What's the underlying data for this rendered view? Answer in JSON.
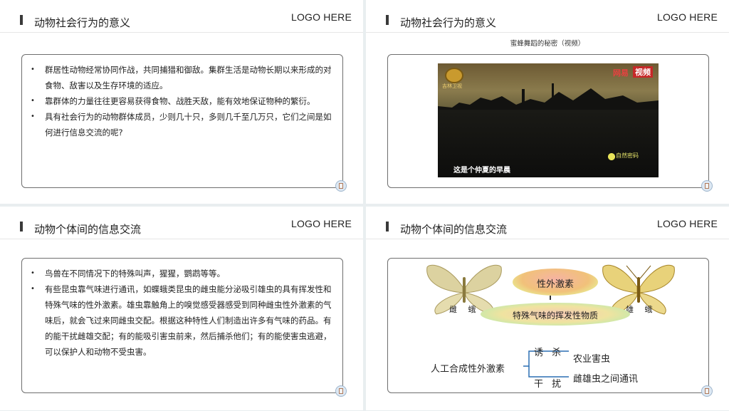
{
  "logo_text": "LOGO HERE",
  "slide1": {
    "title": "动物社会行为的意义",
    "bullets": [
      "群居性动物经常协同作战，共同捕猎和御敌。集群生活是动物长期以来形成的对食物、敌害以及生存环境的适应。",
      "靠群体的力量往往更容易获得食物、战胜天敌，能有效地保证物种的繁衍。",
      "具有社会行为的动物群体成员，少则几十只，多则几千至几万只，它们之间是如何进行信息交流的呢?"
    ]
  },
  "slide2": {
    "title": "动物社会行为的意义",
    "caption": "蜜蜂舞蹈的秘密（视频）",
    "video": {
      "channel_name": "吉林卫视",
      "source_brand": "网易",
      "source_tag": "视频",
      "subtitle": "这是个仲夏的早晨",
      "watermark": "自然密码"
    }
  },
  "slide3": {
    "title": "动物个体间的信息交流",
    "bullets": [
      "鸟兽在不同情况下的特殊叫声，猩猩，鹦鹉等等。",
      "有些昆虫靠气味进行通讯，如蝶蛾类昆虫的雌虫能分泌吸引雄虫的具有挥发性和特殊气味的性外激素。雄虫靠触角上的嗅觉感受器感受到同种雌虫性外激素的气味后，就会飞过来同雌虫交配。根据这种特性人们制造出许多有气味的药品。有的能干扰雌雄交配；有的能吸引害虫前来，然后捕杀他们；有的能使害虫逃避，可以保护人和动物不受虫害。"
    ]
  },
  "slide4": {
    "title": "动物个体间的信息交流",
    "female_moth": "雌 蛾",
    "male_moth": "雄 蛾",
    "hormone": "性外激素",
    "volatile": "特殊气味的挥发性物质",
    "synthetic": "人工合成性外激素",
    "lure": "诱 杀",
    "interfere": "干 扰",
    "pest": "农业害虫",
    "communication": "雌雄虫之间通讯"
  }
}
